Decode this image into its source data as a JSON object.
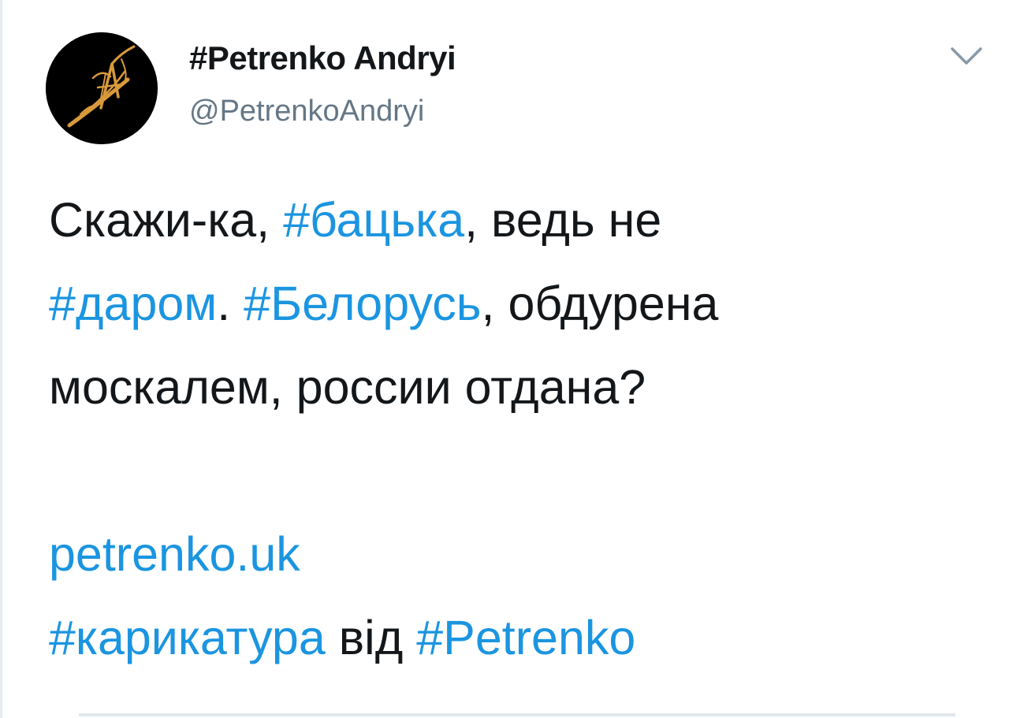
{
  "header": {
    "display_name": "#Petrenko Andryi",
    "handle": "@PetrenkoAndryi",
    "avatar_icon": "signature-logo-icon",
    "menu_icon": "chevron-down-icon"
  },
  "tweet": {
    "line1": {
      "t1": "Скажи-ка, ",
      "h1": "#бацька",
      "t2": ", ведь не"
    },
    "line2": {
      "h1": "#даром",
      "t1": ". ",
      "h2": "#Белорусь",
      "t2": ", обдурена"
    },
    "line3": {
      "t1": "москалем, россии отдана?"
    },
    "link": "petrenko.uk",
    "line5": {
      "h1": "#карикатура",
      "t1": " від ",
      "h2": "#Petrenko"
    }
  },
  "colors": {
    "link": "#1b95e0",
    "text": "#14171a",
    "muted": "#657786",
    "avatar_bg": "#000000",
    "avatar_accent": "#d89a3a"
  }
}
